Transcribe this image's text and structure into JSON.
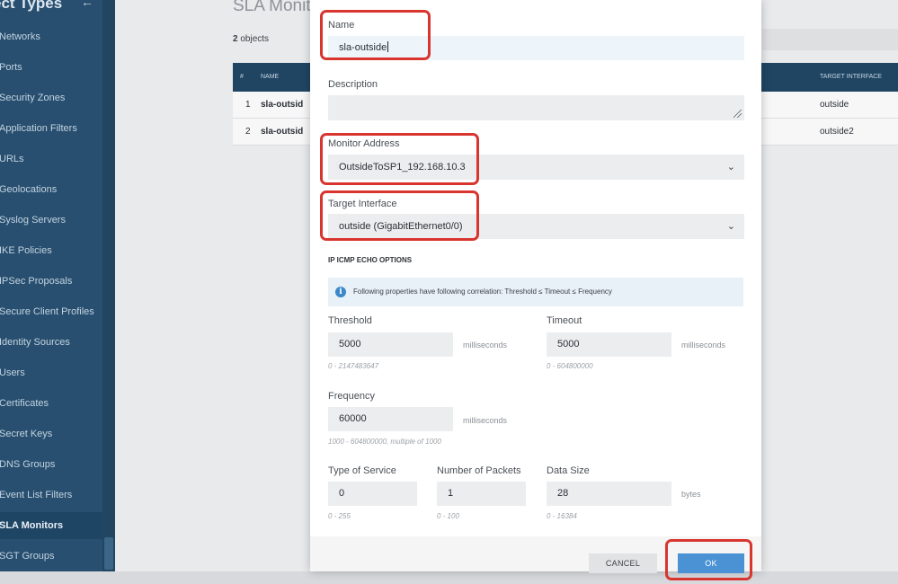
{
  "sidebar": {
    "title": "ect Types",
    "items": [
      {
        "label": "Networks"
      },
      {
        "label": "Ports"
      },
      {
        "label": "Security Zones"
      },
      {
        "label": "Application Filters"
      },
      {
        "label": "URLs"
      },
      {
        "label": "Geolocations"
      },
      {
        "label": "Syslog Servers"
      },
      {
        "label": "IKE Policies"
      },
      {
        "label": "IPSec Proposals"
      },
      {
        "label": "Secure Client Profiles"
      },
      {
        "label": "Identity Sources"
      },
      {
        "label": "Users"
      },
      {
        "label": "Certificates"
      },
      {
        "label": "Secret Keys"
      },
      {
        "label": "DNS Groups"
      },
      {
        "label": "Event List Filters"
      },
      {
        "label": "SLA Monitors",
        "active": true
      },
      {
        "label": "SGT Groups"
      }
    ]
  },
  "main": {
    "title": "SLA Monit",
    "object_count_num": "2",
    "object_count_text": "objects",
    "columns": {
      "num": "#",
      "name": "NAME",
      "target_interface": "TARGET INTERFACE"
    },
    "rows": [
      {
        "num": "1",
        "name": "sla-outsid",
        "target_interface": "outside"
      },
      {
        "num": "2",
        "name": "sla-outsid",
        "target_interface": "outside2"
      }
    ]
  },
  "modal": {
    "name_label": "Name",
    "name_value": "sla-outside",
    "description_label": "Description",
    "description_value": "",
    "monitor_address_label": "Monitor Address",
    "monitor_address_value": "OutsideToSP1_192.168.10.3",
    "target_interface_label": "Target Interface",
    "target_interface_value": "outside (GigabitEthernet0/0)",
    "icmp_section_title": "IP ICMP ECHO OPTIONS",
    "info_text": "Following properties have following correlation: Threshold ≤ Timeout ≤ Frequency",
    "threshold": {
      "label": "Threshold",
      "value": "5000",
      "unit": "milliseconds",
      "range": "0 - 2147483647"
    },
    "timeout": {
      "label": "Timeout",
      "value": "5000",
      "unit": "milliseconds",
      "range": "0 - 604800000"
    },
    "frequency": {
      "label": "Frequency",
      "value": "60000",
      "unit": "milliseconds",
      "range": "1000 - 604800000, multiple of 1000"
    },
    "type_of_service": {
      "label": "Type of Service",
      "value": "0",
      "range": "0 - 255"
    },
    "number_of_packets": {
      "label": "Number of Packets",
      "value": "1",
      "range": "0 - 100"
    },
    "data_size": {
      "label": "Data Size",
      "value": "28",
      "unit": "bytes",
      "range": "0 - 16384"
    },
    "cancel_label": "CANCEL",
    "ok_label": "OK"
  },
  "icons": {
    "select_chevron": "chevron-down-icon",
    "info": "info-icon",
    "collapse": "arrow-left-icon"
  },
  "colors": {
    "sidebar_bg": "#284f6f",
    "table_header_bg": "#1f4563",
    "primary_button": "#4a92d3",
    "annotation_red": "#d9352f"
  }
}
